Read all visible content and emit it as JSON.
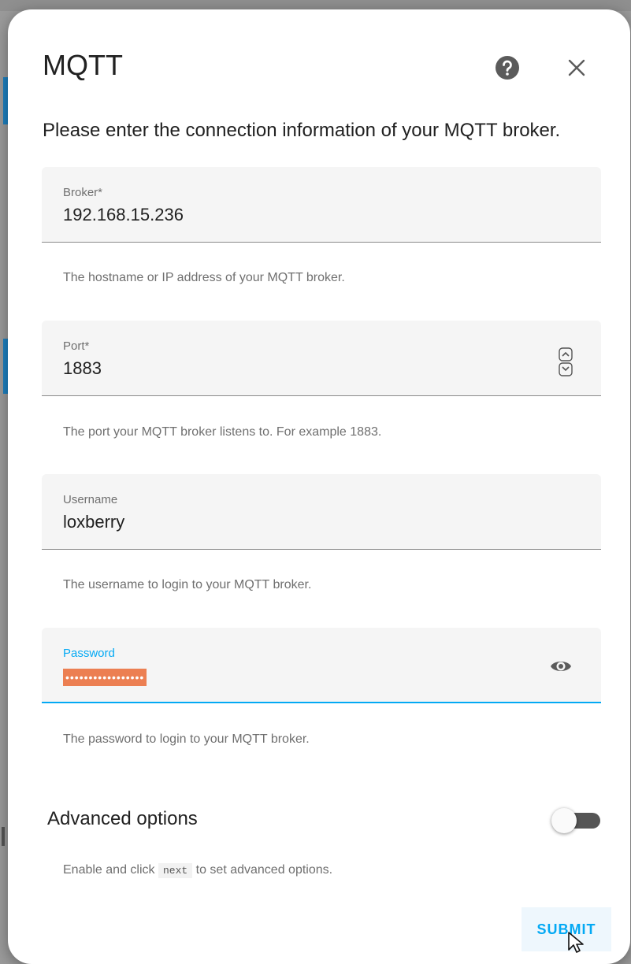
{
  "dialog": {
    "title": "MQTT",
    "description": "Please enter the connection information of your MQTT broker.",
    "icons": {
      "help": "help-circle-icon",
      "close": "close-icon"
    }
  },
  "fields": {
    "broker": {
      "label": "Broker*",
      "value": "192.168.15.236",
      "helper": "The hostname or IP address of your MQTT broker."
    },
    "port": {
      "label": "Port*",
      "value": "1883",
      "helper": "The port your MQTT broker listens to. For example 1883."
    },
    "username": {
      "label": "Username",
      "value": "loxberry",
      "helper": "The username to login to your MQTT broker."
    },
    "password": {
      "label": "Password",
      "value": "•••••••••••••••••",
      "helper": "The password to login to your MQTT broker.",
      "icon": "eye-icon",
      "focused": true
    }
  },
  "advanced": {
    "label": "Advanced options",
    "enabled": false,
    "help_prefix": "Enable and click ",
    "help_code": "next",
    "help_suffix": " to set advanced options."
  },
  "actions": {
    "submit_label": "SUBMIT"
  },
  "colors": {
    "accent": "#03a9f4",
    "password_highlight": "#ec7f52",
    "field_background": "#f5f5f5",
    "toggle_track_off": "#555555"
  }
}
